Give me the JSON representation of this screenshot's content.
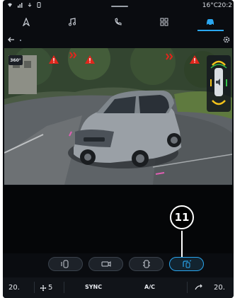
{
  "status": {
    "left_icons": [
      "wifi-icon",
      "signal-icon",
      "download-icon",
      "phone-icon"
    ],
    "temperature": "16°C",
    "time": "20:2"
  },
  "nav": {
    "items": [
      {
        "name": "navigation",
        "icon": "nav-arrow-icon"
      },
      {
        "name": "music",
        "icon": "music-note-icon"
      },
      {
        "name": "phone",
        "icon": "phone-icon"
      },
      {
        "name": "apps",
        "icon": "apps-grid-icon"
      },
      {
        "name": "vehicle",
        "icon": "car-icon",
        "active": true
      }
    ],
    "active_color": "#2aa7f0"
  },
  "view": {
    "mode_label": "360°",
    "callout_number": "11"
  },
  "camera_buttons": [
    {
      "name": "side-view",
      "icon": "car-side-icon",
      "active": false
    },
    {
      "name": "rear-camera",
      "icon": "camera-icon",
      "active": false
    },
    {
      "name": "top-view",
      "icon": "car-top-icon",
      "active": false
    },
    {
      "name": "park-assist",
      "icon": "park-assist-icon",
      "active": true
    }
  ],
  "climate": {
    "left_temp": "20.",
    "fan_speed": "5",
    "sync_label": "SYNC",
    "ac_label": "A/C",
    "right_temp": "20."
  },
  "colors": {
    "warning_red": "#e1261c",
    "accent": "#2aa7f0",
    "sensor_yellow": "#f2c21b",
    "sensor_green": "#36c24a"
  }
}
